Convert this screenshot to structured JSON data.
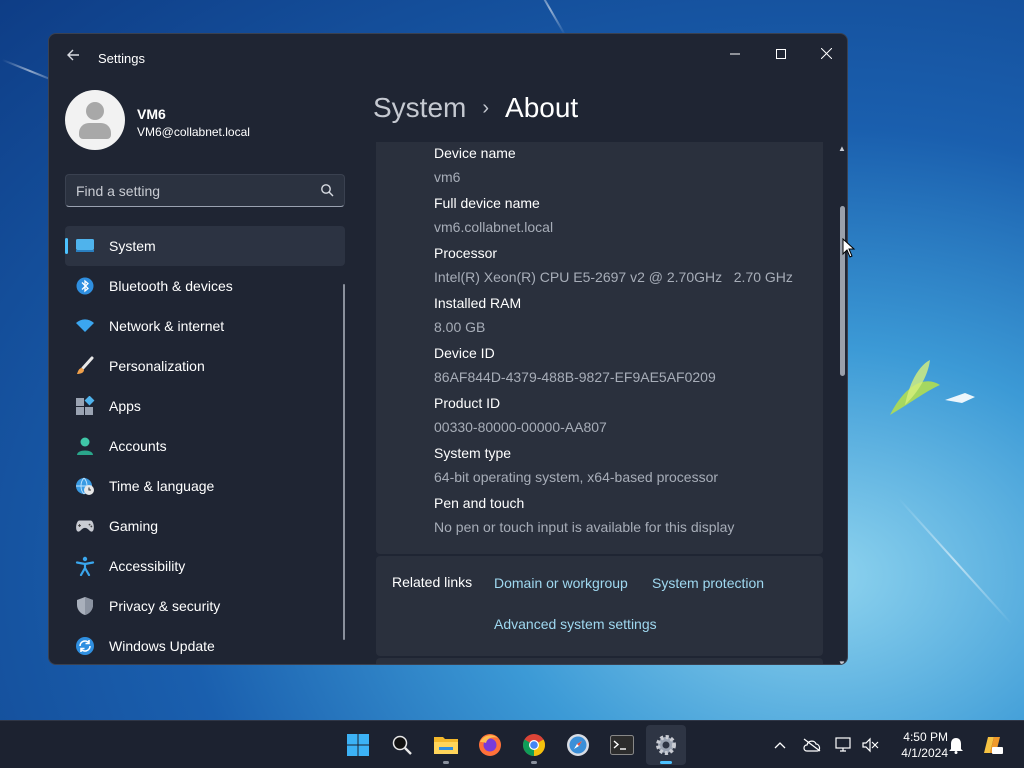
{
  "window": {
    "app_title": "Settings",
    "minimize": "—",
    "maximize": "☐",
    "close": "✕"
  },
  "profile": {
    "name": "VM6",
    "email": "VM6@collabnet.local"
  },
  "search": {
    "placeholder": "Find a setting"
  },
  "sidebar": {
    "items": [
      {
        "label": "System",
        "icon": "system-icon"
      },
      {
        "label": "Bluetooth & devices",
        "icon": "bluetooth-icon"
      },
      {
        "label": "Network & internet",
        "icon": "wifi-icon"
      },
      {
        "label": "Personalization",
        "icon": "brush-icon"
      },
      {
        "label": "Apps",
        "icon": "apps-icon"
      },
      {
        "label": "Accounts",
        "icon": "accounts-icon"
      },
      {
        "label": "Time & language",
        "icon": "globe-clock-icon"
      },
      {
        "label": "Gaming",
        "icon": "gamepad-icon"
      },
      {
        "label": "Accessibility",
        "icon": "accessibility-icon"
      },
      {
        "label": "Privacy & security",
        "icon": "shield-icon"
      },
      {
        "label": "Windows Update",
        "icon": "update-icon"
      }
    ],
    "active_index": 0
  },
  "breadcrumb": {
    "parent": "System",
    "separator": "›",
    "current": "About"
  },
  "specs": [
    {
      "label": "Device name",
      "value": "vm6"
    },
    {
      "label": "Full device name",
      "value": "vm6.collabnet.local"
    },
    {
      "label": "Processor",
      "value": "Intel(R) Xeon(R) CPU E5-2697 v2 @ 2.70GHz   2.70 GHz"
    },
    {
      "label": "Installed RAM",
      "value": "8.00 GB"
    },
    {
      "label": "Device ID",
      "value": "86AF844D-4379-488B-9827-EF9AE5AF0209"
    },
    {
      "label": "Product ID",
      "value": "00330-80000-00000-AA807"
    },
    {
      "label": "System type",
      "value": "64-bit operating system, x64-based processor"
    },
    {
      "label": "Pen and touch",
      "value": "No pen or touch input is available for this display"
    }
  ],
  "related_links": {
    "label": "Related links",
    "links": [
      "Domain or workgroup",
      "System protection",
      "Advanced system settings"
    ]
  },
  "taskbar": {
    "apps": [
      "start-icon",
      "search-icon",
      "file-explorer-icon",
      "firefox-icon",
      "chrome-icon",
      "safari-icon",
      "terminal-icon",
      "settings-icon"
    ],
    "active_app": "settings-icon",
    "clock_time": "4:50 PM",
    "clock_date": "4/1/2024"
  },
  "colors": {
    "accent": "#4cc2ff",
    "link": "#9fd8f0",
    "window_bg": "#1f2533",
    "card_bg": "#2a303d"
  }
}
